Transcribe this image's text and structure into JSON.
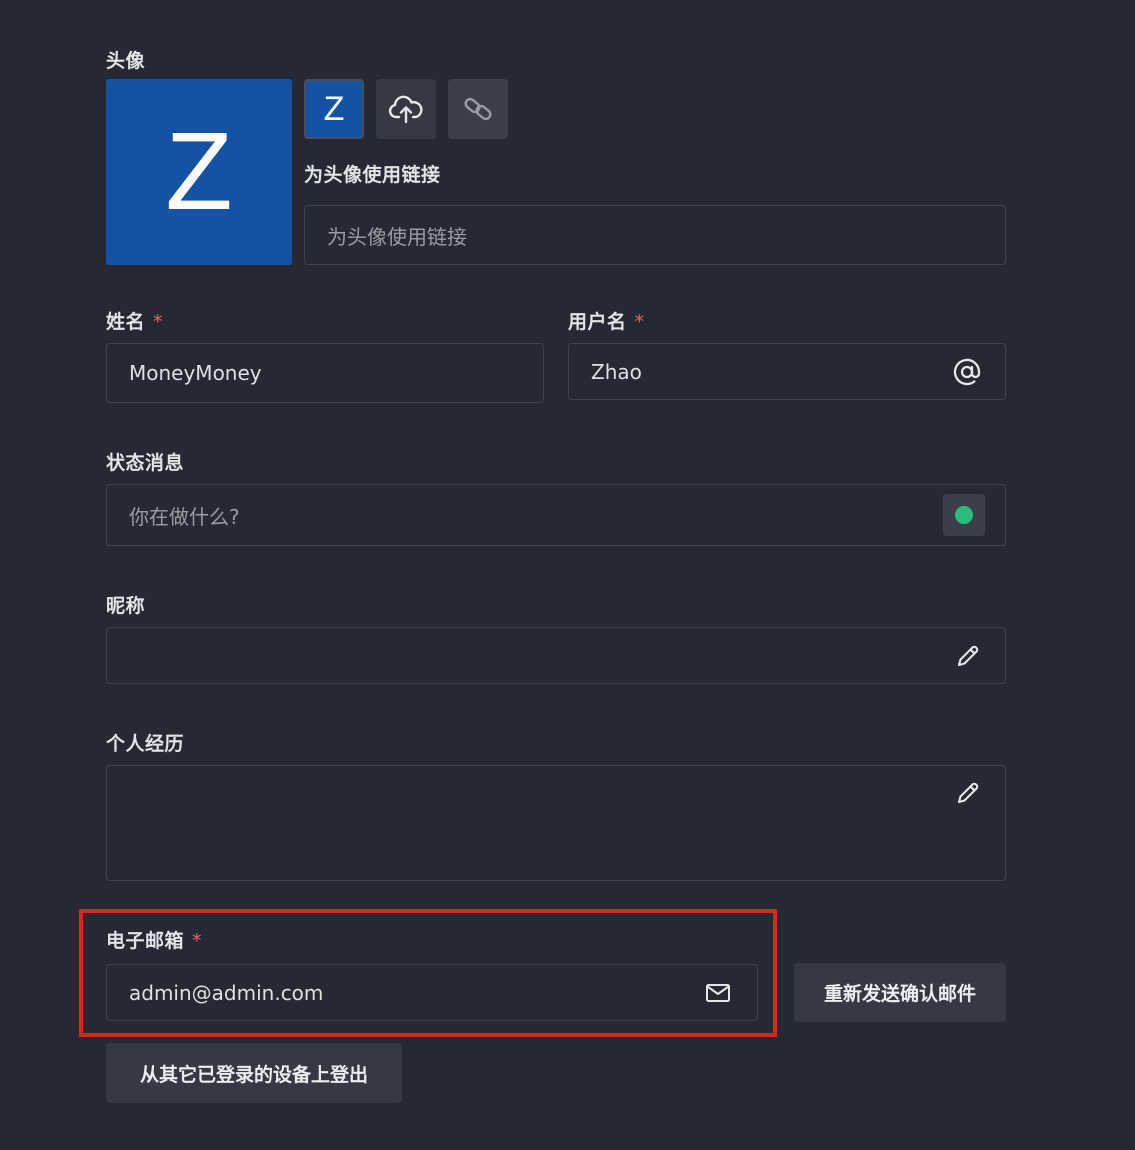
{
  "avatar": {
    "label": "头像",
    "letter": "Z",
    "preview_letter": "Z",
    "bg_color": "#1453a3",
    "link_label": "为头像使用链接",
    "link_placeholder": "为头像使用链接"
  },
  "name": {
    "label": "姓名",
    "required_mark": "*",
    "value": "MoneyMoney"
  },
  "username": {
    "label": "用户名",
    "required_mark": "*",
    "value": "Zhao",
    "icon": "at-icon"
  },
  "status": {
    "label": "状态消息",
    "placeholder": "你在做什么?",
    "status_color": "#2bbd7e"
  },
  "nickname": {
    "label": "昵称",
    "value": "",
    "icon": "pencil-icon"
  },
  "bio": {
    "label": "个人经历",
    "value": "",
    "icon": "pencil-icon"
  },
  "email": {
    "label": "电子邮箱",
    "required_mark": "*",
    "value": "admin@admin.com",
    "icon": "mail-icon",
    "highlight_color": "#e0231b"
  },
  "actions": {
    "resend_label": "重新发送确认邮件",
    "logout_others_label": "从其它已登录的设备上登出"
  }
}
